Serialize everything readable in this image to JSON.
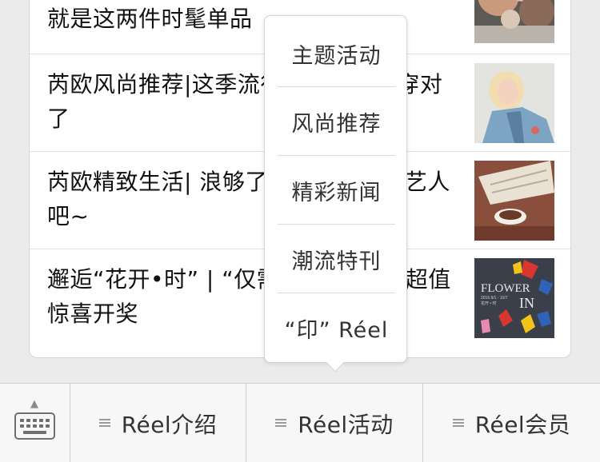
{
  "articles": [
    {
      "title": "就是这两件时髦单品",
      "thumb_icon": "flowers-photo"
    },
    {
      "title": "芮欧风尚推荐|这季流行的牛仔外套穿对了",
      "thumb_icon": "denim-jacket-photo"
    },
    {
      "title": "芮欧精致生活| 浪够了，就来做个文艺人吧~",
      "thumb_icon": "book-coffee-photo"
    },
    {
      "title": "邂逅“花开•时” | “仅需提交订单”的超值惊喜开奖",
      "thumb_icon": "flower-in-poster"
    }
  ],
  "poster": {
    "line1": "FLOWER",
    "line2": "IN",
    "date": "2016.9/1 - 10/7",
    "sub": "花开 • 时"
  },
  "submenu": {
    "items": [
      "主题活动",
      "风尚推荐",
      "精彩新闻",
      "潮流特刊",
      "“印” Réel"
    ]
  },
  "menubar": {
    "keyboard_icon": "keyboard-icon",
    "tabs": [
      "Réel介绍",
      "Réel活动",
      "Réel会员"
    ]
  }
}
